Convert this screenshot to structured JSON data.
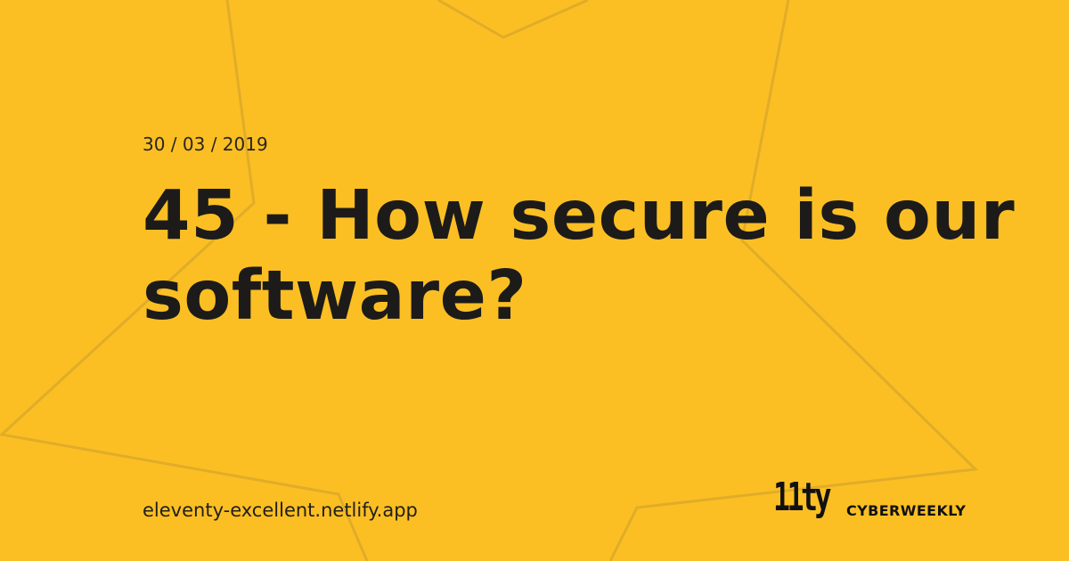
{
  "date": "30 / 03 / 2019",
  "title": "45 - How secure is our software?",
  "site_url": "eleventy-excellent.netlify.app",
  "logo_text": "11ty",
  "brand_name": "CYBERWEEKLY",
  "colors": {
    "background": "#fbbf24",
    "text": "#1c1b1a",
    "shape_stroke": "#d8a62a"
  }
}
